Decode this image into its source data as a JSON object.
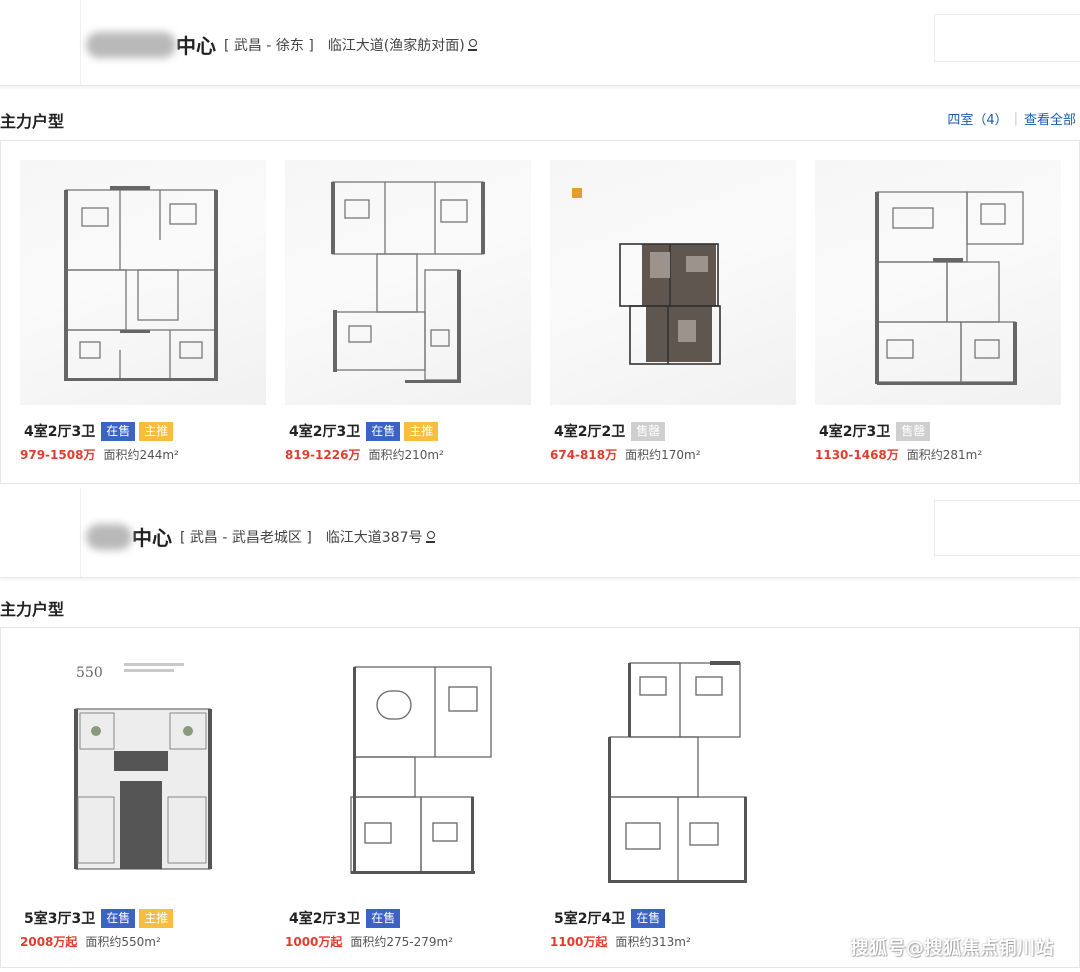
{
  "projects": [
    {
      "name": "中心",
      "area": "[ 武昌 - 徐东 ]",
      "address": "临江大道(渔家舫对面)",
      "section_title": "主力户型",
      "filter_label": "四室（4）",
      "view_all": "查看全部",
      "units": [
        {
          "type": "4室2厅3卫",
          "tags": [
            {
              "text": "在售",
              "kind": "sale"
            },
            {
              "text": "主推",
              "kind": "main"
            }
          ],
          "price": "979-1508万",
          "area": "面积约244m²"
        },
        {
          "type": "4室2厅3卫",
          "tags": [
            {
              "text": "在售",
              "kind": "sale"
            },
            {
              "text": "主推",
              "kind": "main"
            }
          ],
          "price": "819-1226万",
          "area": "面积约210m²"
        },
        {
          "type": "4室2厅2卫",
          "tags": [
            {
              "text": "售罄",
              "kind": "sold"
            }
          ],
          "price": "674-818万",
          "area": "面积约170m²"
        },
        {
          "type": "4室2厅3卫",
          "tags": [
            {
              "text": "售罄",
              "kind": "sold"
            }
          ],
          "price": "1130-1468万",
          "area": "面积约281m²"
        }
      ]
    },
    {
      "name": "中心",
      "area": "[ 武昌 - 武昌老城区 ]",
      "address": "临江大道387号",
      "section_title": "主力户型",
      "units": [
        {
          "type": "5室3厅3卫",
          "tags": [
            {
              "text": "在售",
              "kind": "sale"
            },
            {
              "text": "主推",
              "kind": "main"
            }
          ],
          "price": "2008万起",
          "area": "面积约550m²",
          "plan_label": "550"
        },
        {
          "type": "4室2厅3卫",
          "tags": [
            {
              "text": "在售",
              "kind": "sale"
            }
          ],
          "price": "1000万起",
          "area": "面积约275-279m²"
        },
        {
          "type": "5室2厅4卫",
          "tags": [
            {
              "text": "在售",
              "kind": "sale"
            }
          ],
          "price": "1100万起",
          "area": "面积约313m²"
        }
      ]
    }
  ],
  "watermark": "搜狐号@搜狐焦点铜川站",
  "colors": {
    "price": "#e23c2e",
    "on_sale": "#3b62c4",
    "featured": "#f6bd3f",
    "sold_out": "#cfcfcf",
    "link": "#1c5cb0"
  }
}
